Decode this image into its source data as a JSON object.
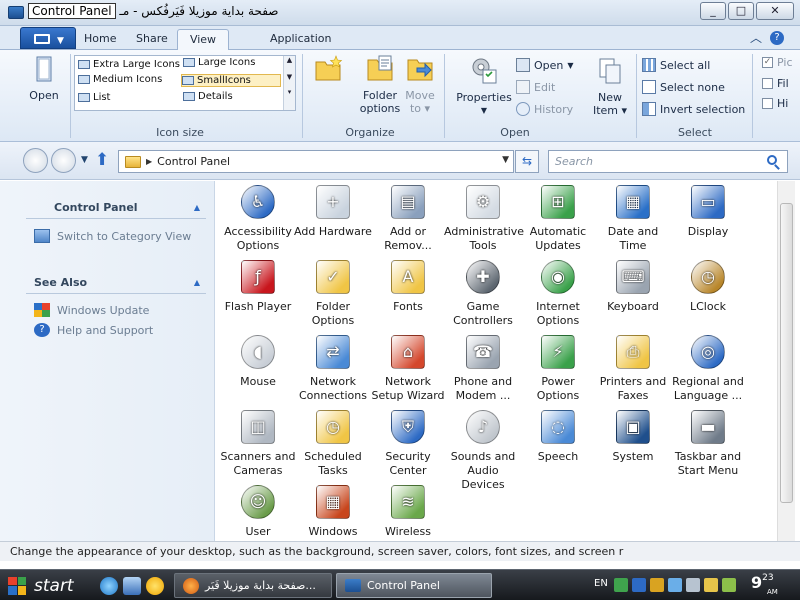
{
  "window": {
    "title_selected": "Control Panel",
    "title_rest": "صفحة بداية موزيلا فَيَرفُكس - مـ",
    "min_label": "_",
    "max_label": "□",
    "close_label": "✕"
  },
  "ribbon": {
    "tabs": [
      "Home",
      "Share",
      "View",
      "Application"
    ],
    "active_tab": "View",
    "groups": {
      "pane": {
        "open_label": "Open"
      },
      "layout": {
        "label": "Icon size",
        "options": [
          "Extra Large Icons",
          "Large Icons",
          "Medium Icons",
          "SmallIcons",
          "List",
          "Details"
        ],
        "selected": "SmallIcons"
      },
      "organize": {
        "label": "Organize",
        "folder_options_line1": "Folder",
        "folder_options_line2": "options",
        "move_to_line1": "Move",
        "move_to_line2": "to"
      },
      "open": {
        "label": "Open",
        "properties": "Properties",
        "open": "Open",
        "edit": "Edit",
        "history": "History",
        "new_item_line1": "New",
        "new_item_line2": "Item"
      },
      "select": {
        "label": "Select",
        "select_all": "Select all",
        "select_none": "Select none",
        "invert": "Invert selection"
      },
      "showhide": {
        "items": [
          "Pic",
          "Fil",
          "Hi"
        ]
      }
    }
  },
  "nav": {
    "path": "Control Panel",
    "search_placeholder": "Search"
  },
  "leftpane": {
    "cp_header": "Control Panel",
    "switch_view": "Switch to Category View",
    "see_also_header": "See Also",
    "links": [
      "Windows Update",
      "Help and Support"
    ]
  },
  "items": [
    {
      "label": "Accessibility Options",
      "icon": "accessibility-icon"
    },
    {
      "label": "Add Hardware",
      "icon": "add-hardware-icon"
    },
    {
      "label": "Add or Remov...",
      "icon": "add-remove-icon"
    },
    {
      "label": "Administrative Tools",
      "icon": "admin-tools-icon"
    },
    {
      "label": "Automatic Updates",
      "icon": "auto-updates-icon"
    },
    {
      "label": "Date and Time",
      "icon": "date-time-icon"
    },
    {
      "label": "Display",
      "icon": "display-icon"
    },
    {
      "label": "Flash Player",
      "icon": "flash-icon"
    },
    {
      "label": "Folder Options",
      "icon": "folder-options-icon"
    },
    {
      "label": "Fonts",
      "icon": "fonts-icon"
    },
    {
      "label": "Game Controllers",
      "icon": "gamepad-icon"
    },
    {
      "label": "Internet Options",
      "icon": "internet-icon"
    },
    {
      "label": "Keyboard",
      "icon": "keyboard-icon"
    },
    {
      "label": "LClock",
      "icon": "lclock-icon"
    },
    {
      "label": "Mouse",
      "icon": "mouse-icon"
    },
    {
      "label": "Network Connections",
      "icon": "network-icon"
    },
    {
      "label": "Network Setup Wizard",
      "icon": "network-wizard-icon"
    },
    {
      "label": "Phone and Modem ...",
      "icon": "phone-icon"
    },
    {
      "label": "Power Options",
      "icon": "power-icon"
    },
    {
      "label": "Printers and Faxes",
      "icon": "printer-icon"
    },
    {
      "label": "Regional and Language ...",
      "icon": "globe-icon"
    },
    {
      "label": "Scanners and Cameras",
      "icon": "scanner-icon"
    },
    {
      "label": "Scheduled Tasks",
      "icon": "scheduled-icon"
    },
    {
      "label": "Security Center",
      "icon": "security-icon"
    },
    {
      "label": "Sounds and Audio Devices",
      "icon": "sound-icon"
    },
    {
      "label": "Speech",
      "icon": "speech-icon"
    },
    {
      "label": "System",
      "icon": "system-icon"
    },
    {
      "label": "Taskbar and Start Menu",
      "icon": "taskbar-icon"
    },
    {
      "label": "User",
      "icon": "users-icon"
    },
    {
      "label": "Windows",
      "icon": "firewall-icon"
    },
    {
      "label": "Wireless",
      "icon": "wireless-icon"
    }
  ],
  "status": "Change the appearance of your desktop, such as the background, screen saver, colors, font sizes, and screen r",
  "taskbar": {
    "start": "start",
    "tasks": [
      "صفحة بداية موزيلا فَيَر...",
      "Control Panel"
    ],
    "lang": "EN",
    "clock_hour": "9",
    "clock_min": "23",
    "clock_ampm": "AM"
  },
  "colors": {
    "accent": "#2d6ac4",
    "ribbon_bg": "#dde8f5",
    "taskbar_bg": "#16191d"
  }
}
